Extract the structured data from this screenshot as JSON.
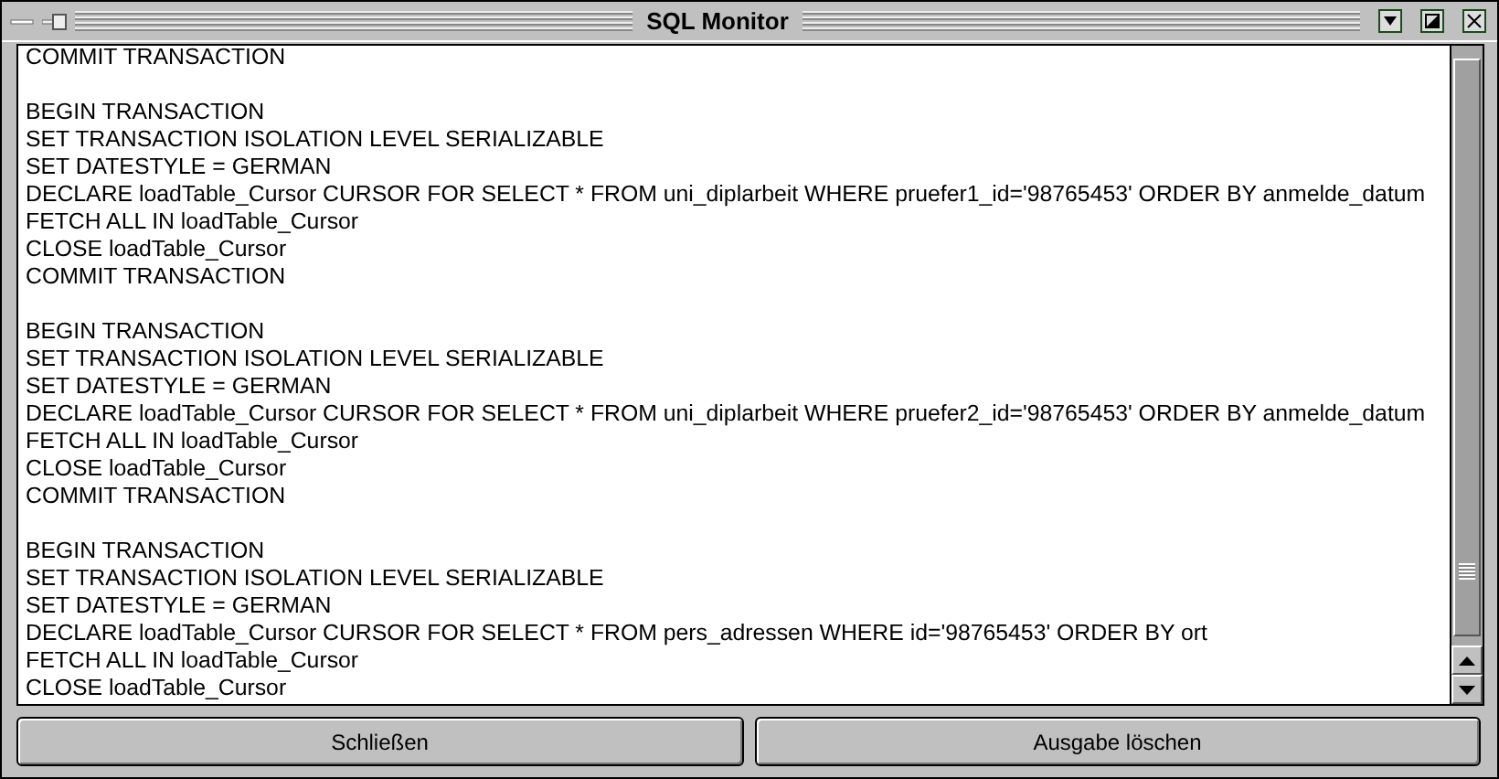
{
  "window": {
    "title": "SQL Monitor"
  },
  "log_blocks": [
    {
      "lines": [
        "COMMIT TRANSACTION"
      ]
    },
    {
      "lines": [
        "BEGIN TRANSACTION",
        "SET TRANSACTION ISOLATION LEVEL SERIALIZABLE",
        "SET DATESTYLE = GERMAN",
        "DECLARE loadTable_Cursor CURSOR FOR SELECT * FROM uni_diplarbeit WHERE pruefer1_id='98765453' ORDER BY anmelde_datum",
        "FETCH ALL IN loadTable_Cursor",
        "CLOSE loadTable_Cursor",
        "COMMIT TRANSACTION"
      ]
    },
    {
      "lines": [
        "BEGIN TRANSACTION",
        "SET TRANSACTION ISOLATION LEVEL SERIALIZABLE",
        "SET DATESTYLE = GERMAN",
        "DECLARE loadTable_Cursor CURSOR FOR SELECT * FROM uni_diplarbeit WHERE pruefer2_id='98765453' ORDER BY anmelde_datum",
        "FETCH ALL IN loadTable_Cursor",
        "CLOSE loadTable_Cursor",
        "COMMIT TRANSACTION"
      ]
    },
    {
      "lines": [
        "BEGIN TRANSACTION",
        "SET TRANSACTION ISOLATION LEVEL SERIALIZABLE",
        "SET DATESTYLE = GERMAN",
        "DECLARE loadTable_Cursor CURSOR FOR SELECT * FROM pers_adressen WHERE id='98765453' ORDER BY ort",
        "FETCH ALL IN loadTable_Cursor",
        "CLOSE loadTable_Cursor"
      ]
    }
  ],
  "buttons": [
    "Schließen",
    "Ausgabe löschen"
  ]
}
